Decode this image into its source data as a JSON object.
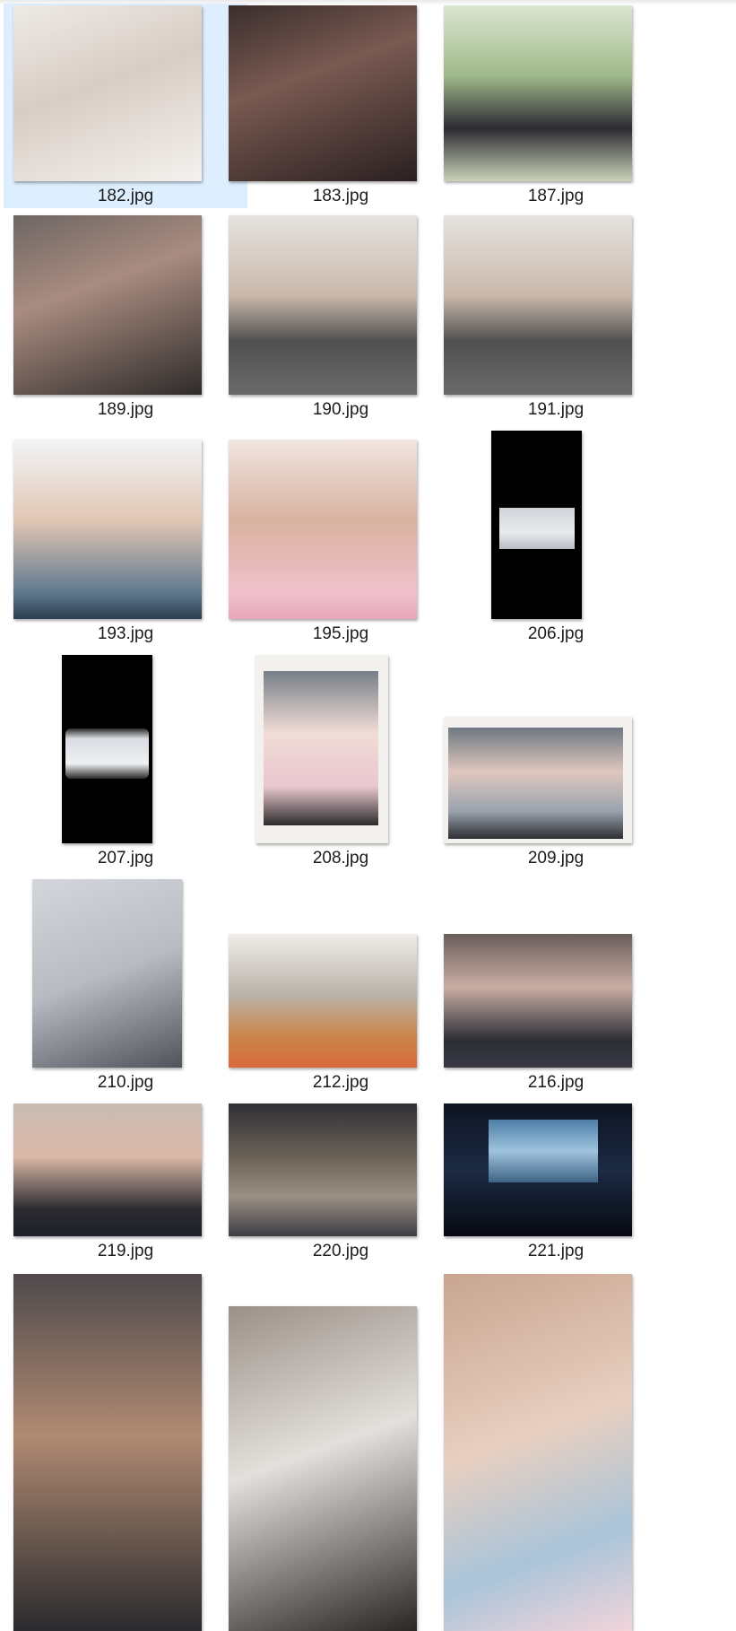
{
  "window": {
    "title": ""
  },
  "files": [
    {
      "name": "182.jpg",
      "thumb": "portrait-white-background",
      "selected": true
    },
    {
      "name": "183.jpg",
      "thumb": "portrait-cap-dark"
    },
    {
      "name": "187.jpg",
      "thumb": "portrait-graduation-park"
    },
    {
      "name": "189.jpg",
      "thumb": "selfie-car"
    },
    {
      "name": "190.jpg",
      "thumb": "selfie-sweater"
    },
    {
      "name": "191.jpg",
      "thumb": "selfie-sweater"
    },
    {
      "name": "193.jpg",
      "thumb": "selfie-peace-sign"
    },
    {
      "name": "195.jpg",
      "thumb": "selfie-pink-top"
    },
    {
      "name": "206.jpg",
      "thumb": "vertical-video-frame-studio"
    },
    {
      "name": "207.jpg",
      "thumb": "vertical-video-frame-phone"
    },
    {
      "name": "208.jpg",
      "thumb": "instant-photo-two-people"
    },
    {
      "name": "209.jpg",
      "thumb": "instant-photo-group"
    },
    {
      "name": "210.jpg",
      "thumb": "studio-camera-interview"
    },
    {
      "name": "212.jpg",
      "thumb": "party-table-pizza"
    },
    {
      "name": "216.jpg",
      "thumb": "three-friends-snowflakes"
    },
    {
      "name": "219.jpg",
      "thumb": "four-friends-selfie"
    },
    {
      "name": "220.jpg",
      "thumb": "group-photo-indoor"
    },
    {
      "name": "221.jpg",
      "thumb": "movie-screen-dark-room"
    },
    {
      "name": "",
      "thumb": "portrait-gym"
    },
    {
      "name": "",
      "thumb": "room-two-people"
    },
    {
      "name": "",
      "thumb": "lying-in-bed"
    }
  ]
}
